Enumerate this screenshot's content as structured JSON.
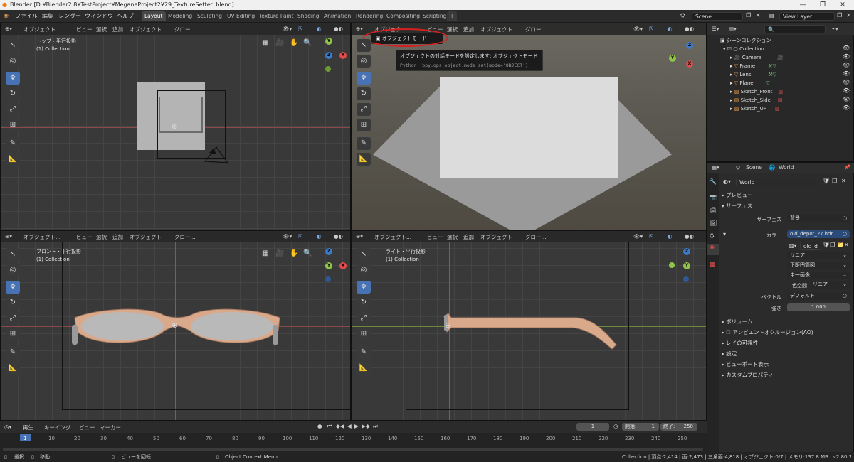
{
  "window": {
    "title": "Blender [D:¥Blender2.8¥TestProject¥MeganeProject2¥29_TextureSetted.blend]"
  },
  "menus": [
    "ファイル",
    "編集",
    "レンダー",
    "ウィンドウ",
    "ヘルプ"
  ],
  "workspaces": [
    "Layout",
    "Modeling",
    "Sculpting",
    "UV Editing",
    "Texture Paint",
    "Shading",
    "Animation",
    "Rendering",
    "Compositing",
    "Scripting"
  ],
  "active_workspace": "Layout",
  "scene": "Scene",
  "view_layer": "View Layer",
  "viewport_header": {
    "mode": "オブジェクト...",
    "view": "ビュー",
    "select": "選択",
    "add": "追加",
    "object": "オブジェクト",
    "orientation": "グロー..."
  },
  "viewports": {
    "top": {
      "name": "トップ・平行投影",
      "collection": "(1) Collection"
    },
    "camera": {
      "mode": "オブジェク...",
      "view": "ビュー",
      "select": "選択",
      "add": "追加",
      "object": "オブジェクト",
      "orientation": "グロー...",
      "dropdown_item": "オブジェクトモード",
      "tooltip_title": "オブジェクトの対話モードを設定します: オブジェクトモード",
      "tooltip_python": "Python: bpy.ops.object.mode_set(mode='OBJECT')"
    },
    "front": {
      "name": "フロント・平行投影",
      "collection": "(1) Collection"
    },
    "right": {
      "name": "ライト・平行投影",
      "collection": "(1) Collection"
    }
  },
  "outliner": {
    "root": "シーンコレクション",
    "collection": "Collection",
    "items": [
      "Camera",
      "Frame",
      "Lens",
      "Plane",
      "Sketch_Front",
      "Sketch_Side",
      "Sketch_UP"
    ]
  },
  "properties": {
    "tab_scene": "Scene",
    "tab_world": "World",
    "world_name": "World",
    "sec_preview": "プレビュー",
    "sec_surface": "サーフェス",
    "surface_label": "サーフェス",
    "surface_value": "背景",
    "color_label": "カラー",
    "color_value": "old_depot_2k.hdr",
    "image_name": "old_d",
    "interp": "リニア",
    "projection": "正距円筒図",
    "source": "単一画像",
    "colorspace_label": "色空間",
    "colorspace_value": "リニア",
    "vector_label": "ベクトル",
    "vector_value": "デフォルト",
    "strength_label": "強さ",
    "strength_value": "1.000",
    "sections": [
      "ボリューム",
      "アンビエントオクルージョン(AO)",
      "レイの可視性",
      "設定",
      "ビューポート表示",
      "カスタムプロパティ"
    ]
  },
  "timeline": {
    "playback": "再生",
    "keying": "キーイング",
    "view": "ビュー",
    "marker": "マーカー",
    "current_frame": "1",
    "start_label": "開始:",
    "start": "1",
    "end_label": "終了:",
    "end": "250",
    "ticks": [
      "1",
      "10",
      "20",
      "30",
      "40",
      "50",
      "60",
      "70",
      "80",
      "90",
      "100",
      "110",
      "120",
      "130",
      "140",
      "150",
      "160",
      "170",
      "180",
      "190",
      "200",
      "210",
      "220",
      "230",
      "240",
      "250"
    ]
  },
  "status": {
    "select": "選択",
    "move": "移動",
    "rotate_view": "ビューを回転",
    "context_menu": "Object Context Menu",
    "info": "Collection | 頂点:2,414 | 面:2,473 | 三角面:4,818 | オブジェクト:0/7 | メモリ:137.8 MB | v2.80.75"
  },
  "colors": {
    "accent": "#4772b3",
    "highlight_circle": "#d62020",
    "glasses": "#d8a98a"
  }
}
